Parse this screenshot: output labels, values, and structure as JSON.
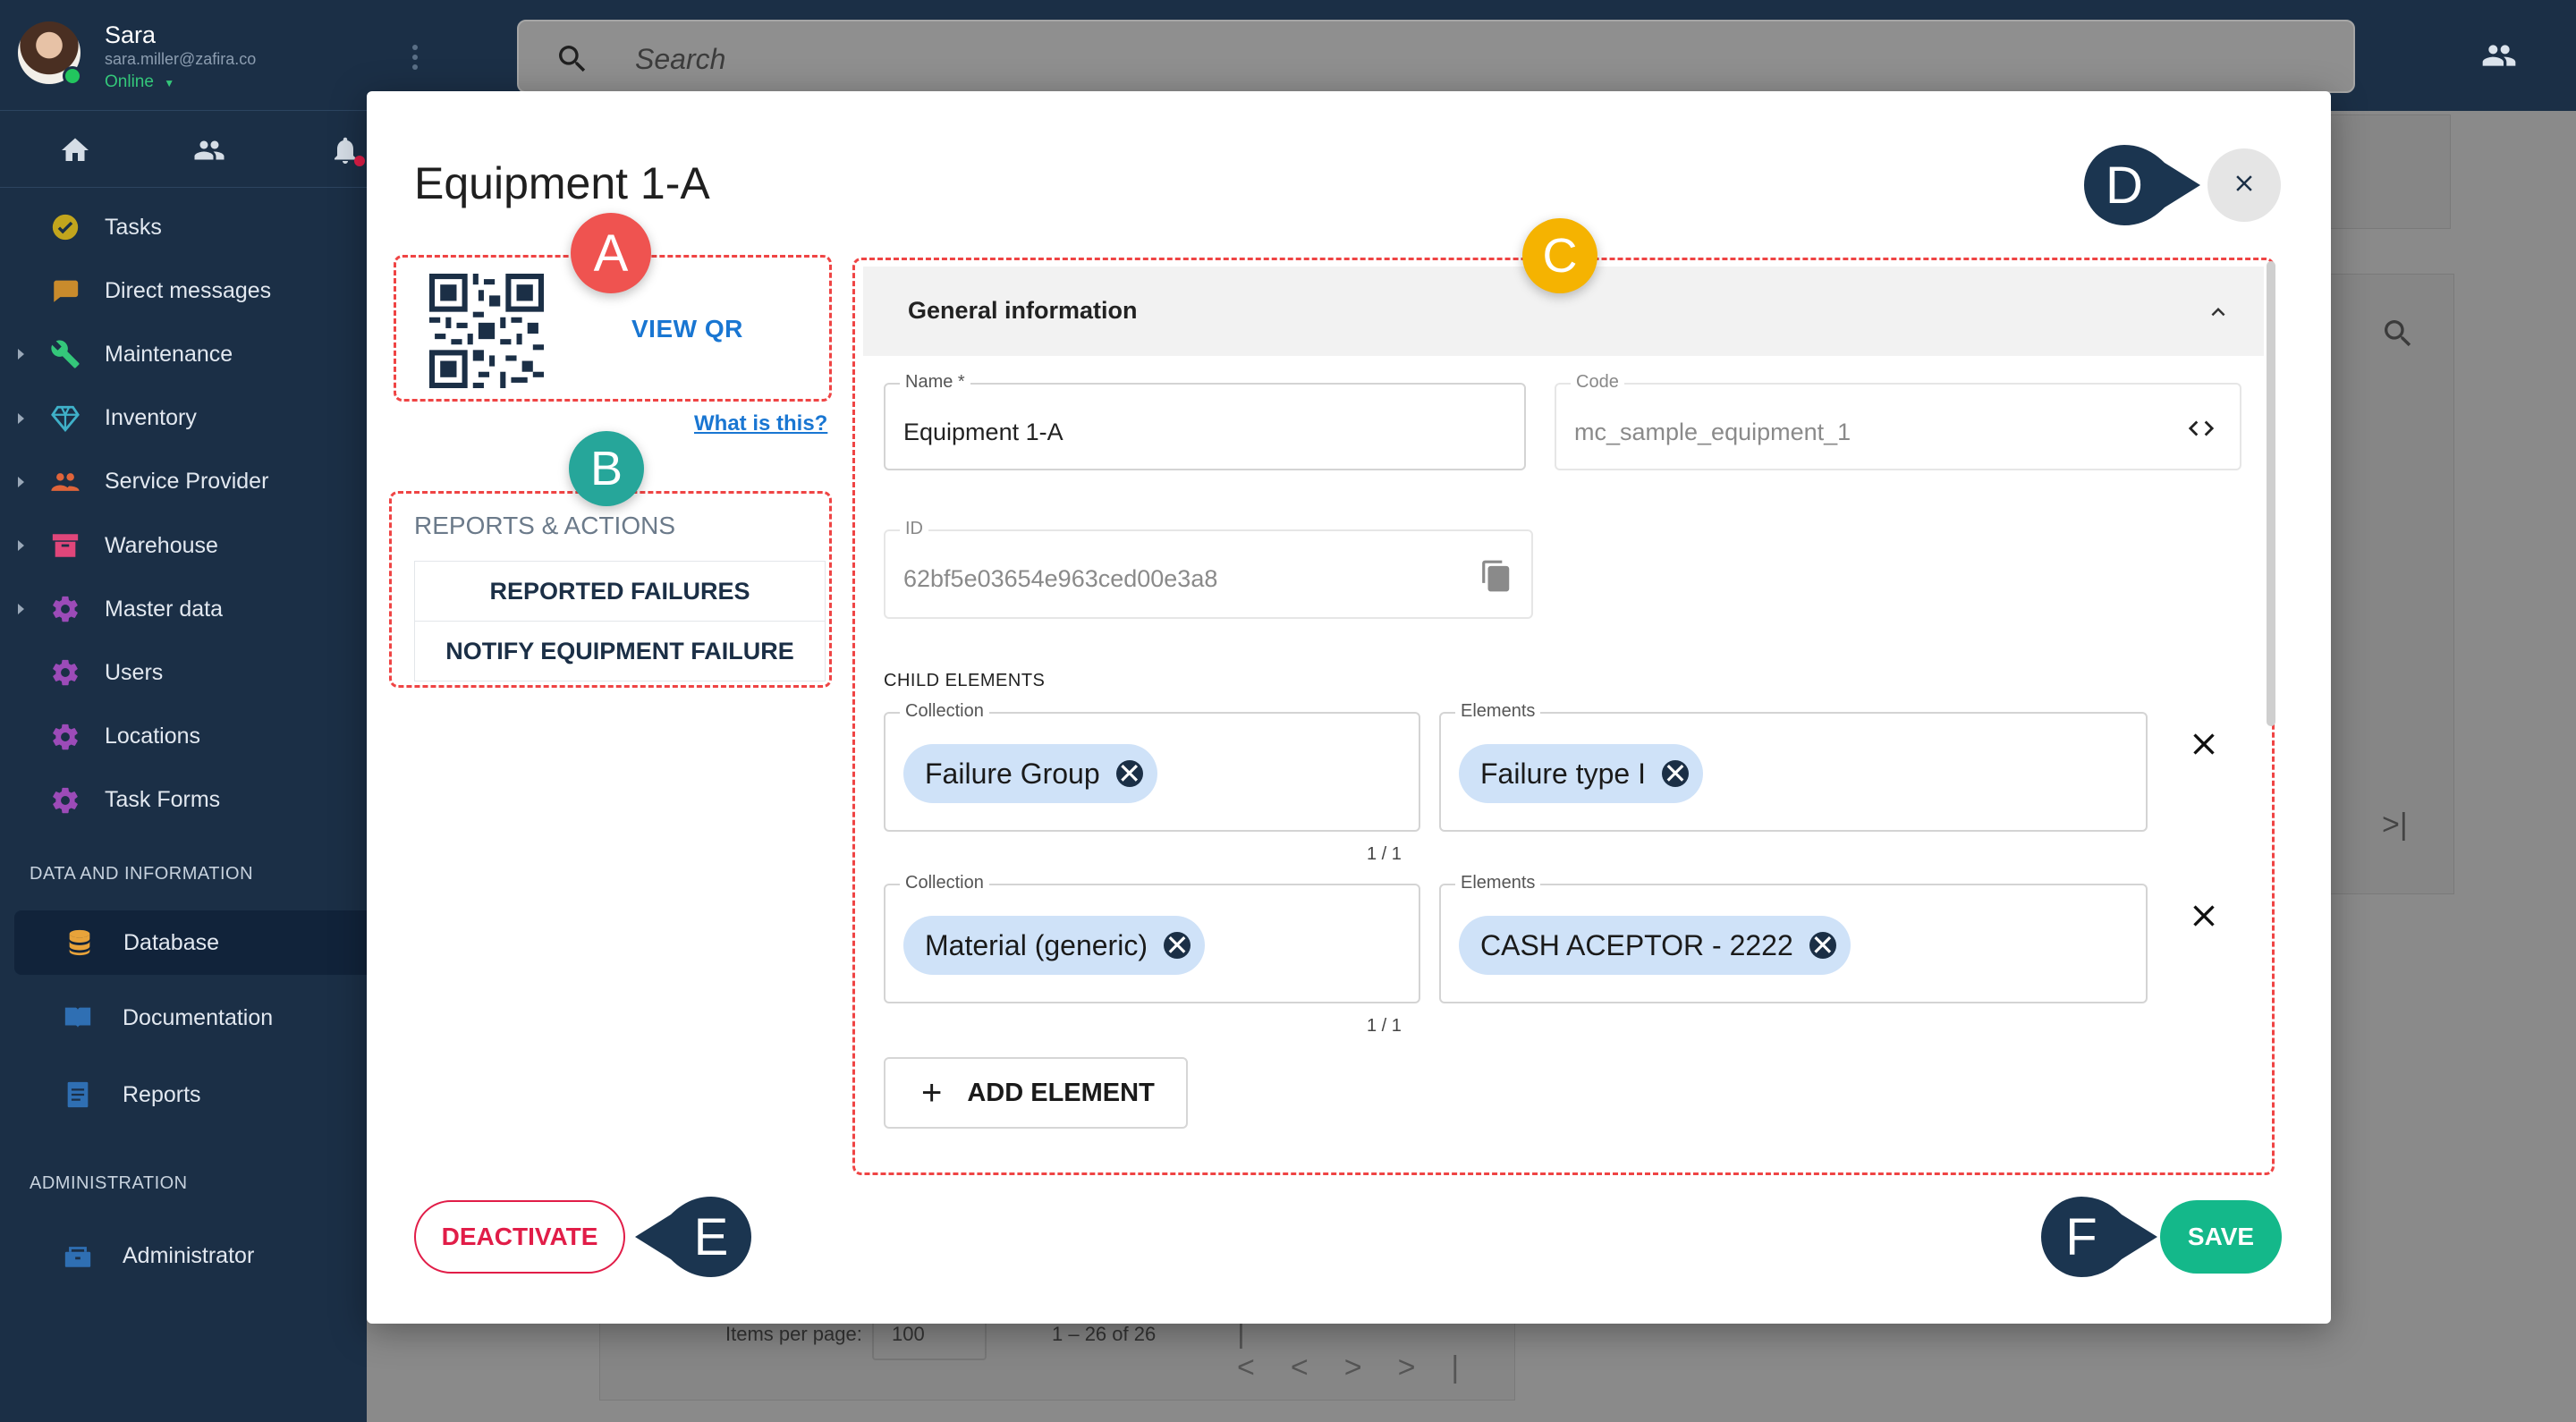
{
  "user": {
    "name": "Sara",
    "email": "sara.miller@zafira.co",
    "status": "Online"
  },
  "sidebar": {
    "items": [
      {
        "label": "Tasks",
        "icon": "check-circle-icon",
        "color": "#c2a51d",
        "expandable": false
      },
      {
        "label": "Direct messages",
        "icon": "chat-bubble-icon",
        "color": "#c98b2c",
        "expandable": false
      },
      {
        "label": "Maintenance",
        "icon": "wrench-icon",
        "color": "#34c77a",
        "expandable": true
      },
      {
        "label": "Inventory",
        "icon": "diamond-icon",
        "color": "#3fb1c9",
        "expandable": true
      },
      {
        "label": "Service Provider",
        "icon": "people-icon",
        "color": "#e0643a",
        "expandable": true
      },
      {
        "label": "Warehouse",
        "icon": "archive-box-icon",
        "color": "#e0467a",
        "expandable": true
      },
      {
        "label": "Master data",
        "icon": "gear-icon",
        "color": "#9c4bb8",
        "expandable": true
      },
      {
        "label": "Users",
        "icon": "gear-icon",
        "color": "#9c4bb8",
        "expandable": false
      },
      {
        "label": "Locations",
        "icon": "gear-icon",
        "color": "#9c4bb8",
        "expandable": false
      },
      {
        "label": "Task Forms",
        "icon": "gear-icon",
        "color": "#9c4bb8",
        "expandable": false
      }
    ],
    "data_section": {
      "header": "DATA AND INFORMATION",
      "items": [
        {
          "label": "Database",
          "icon": "database-icon",
          "color": "#e8a33a"
        },
        {
          "label": "Documentation",
          "icon": "book-icon",
          "color": "#2f6fb3"
        },
        {
          "label": "Reports",
          "icon": "document-icon",
          "color": "#2f6fb3"
        }
      ]
    },
    "admin_section": {
      "header": "ADMINISTRATION",
      "items": [
        {
          "label": "Administrator",
          "icon": "admin-box-icon",
          "color": "#2f6fb3"
        }
      ]
    }
  },
  "search": {
    "placeholder": "Search"
  },
  "background": {
    "pagination": {
      "items_per_page_label": "Items per page:",
      "items_per_page_value": "100",
      "range": "1 – 26 of 26"
    }
  },
  "modal": {
    "title": "Equipment 1-A",
    "view_qr": "VIEW QR",
    "what_is_this": "What is this?",
    "reports_title": "REPORTS & ACTIONS",
    "actions": [
      "REPORTED FAILURES",
      "NOTIFY EQUIPMENT FAILURE"
    ],
    "panel_title": "General information",
    "fields": {
      "name": {
        "label": "Name *",
        "value": "Equipment 1-A"
      },
      "code": {
        "label": "Code",
        "value": "mc_sample_equipment_1"
      },
      "id": {
        "label": "ID",
        "value": "62bf5e03654e963ced00e3a8"
      }
    },
    "child_elements_label": "CHILD ELEMENTS",
    "child_rows": [
      {
        "collection_label": "Collection",
        "collection": "Failure Group",
        "elements_label": "Elements",
        "element": "Failure type I",
        "counter": "1 / 1"
      },
      {
        "collection_label": "Collection",
        "collection": "Material (generic)",
        "elements_label": "Elements",
        "element": "CASH ACEPTOR - 2222",
        "counter": "1 / 1"
      }
    ],
    "add_element": "ADD ELEMENT",
    "deactivate": "DEACTIVATE",
    "save": "SAVE"
  },
  "callouts": {
    "a": {
      "letter": "A",
      "color": "#ef5350"
    },
    "b": {
      "letter": "B",
      "color": "#26a69a"
    },
    "c": {
      "letter": "C",
      "color": "#f5b301"
    },
    "d": {
      "letter": "D",
      "color": "#1b3550"
    },
    "e": {
      "letter": "E",
      "color": "#1b3550"
    },
    "f": {
      "letter": "F",
      "color": "#1b3550"
    }
  },
  "colors": {
    "sidebar_bg": "#1b2f46",
    "accent_blue": "#1976d2",
    "save_green": "#14b88a",
    "deactivate_red": "#e11d48",
    "callout_dashed": "#ef4444"
  }
}
